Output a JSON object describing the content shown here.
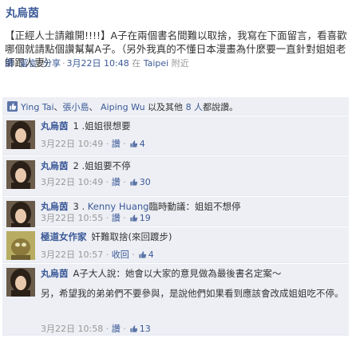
{
  "post": {
    "author": "丸烏茵",
    "text": "【正經人士請離開!!!!】A子在兩個書名間難以取捨，我寫在下面留言，看喜歡哪個就請點個讚幫幫A子。（另外我真的不懂日本漫畫為什麼要一直針對姐姐老師跟人妻）",
    "actions": {
      "like": "讚",
      "comment": "留言",
      "share": "分享",
      "timestamp": "3月22日 10:48",
      "location_prefix": "在",
      "location": "Taipei",
      "location_suffix": "附近"
    }
  },
  "likes_summary": {
    "user1": "Ying Tai",
    "user2": "張小島",
    "user3": "Aiping Wu",
    "and_others_prefix": "以及其他",
    "others_count": "8 人",
    "suffix": "都說讚。"
  },
  "comments": [
    {
      "author": "丸烏茵",
      "text": "1 .姐姐很想要",
      "timestamp": "3月22日 10:49",
      "action": "讚",
      "likes": "4"
    },
    {
      "author": "丸烏茵",
      "text": "2 .姐姐要不停",
      "timestamp": "3月22日 10:49",
      "action": "讚",
      "likes": "30"
    },
    {
      "author": "丸烏茵",
      "text_prefix": "3 . ",
      "mention": "Kenny Huang",
      "text_suffix": "臨時動議：姐姐不想停",
      "timestamp": "3月22日 10:55",
      "action": "讚",
      "likes": "19"
    },
    {
      "author": "極道女作家",
      "text": "奸難取捨(來回踱步)",
      "timestamp": "3月22日 10:57",
      "action": "收回",
      "likes": "4"
    },
    {
      "author": "丸烏茵",
      "text": "A子大人說：她會以大家的意見做為最後書名定案～",
      "text2": "另，希望我的弟弟們不要參與，是說他們如果看到應該會改成姐姐吃不停。",
      "timestamp": "3月22日 10:58",
      "action": "讚",
      "likes": "13"
    }
  ],
  "colors": {
    "link": "#3b5998",
    "meta": "#999999",
    "comment_bg": "#edeff4"
  }
}
